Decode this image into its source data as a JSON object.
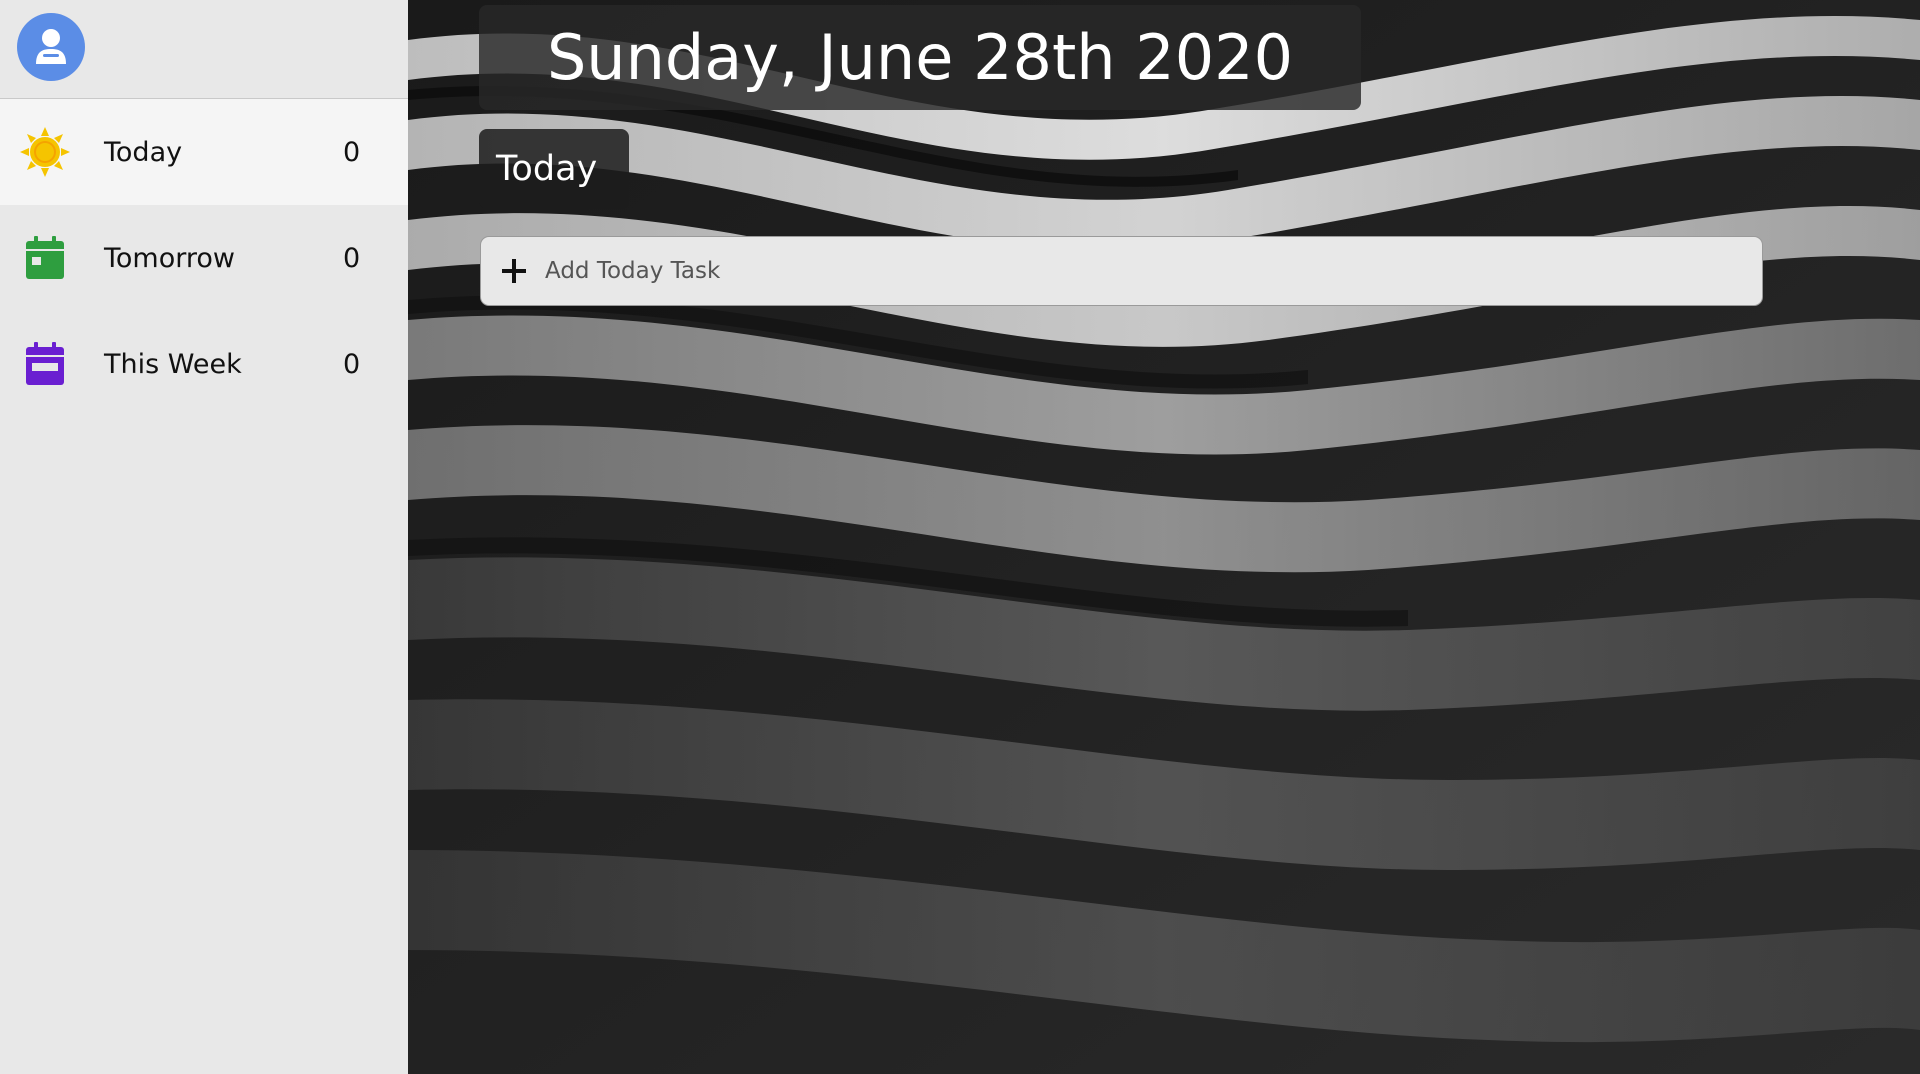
{
  "header": {
    "date_title": "Sunday, June 28th 2020"
  },
  "sidebar": {
    "avatar_icon": "user-icon",
    "items": [
      {
        "label": "Today",
        "count": "0",
        "icon": "sun-icon",
        "color": "#f5c400",
        "active": true
      },
      {
        "label": "Tomorrow",
        "count": "0",
        "icon": "calendar-icon",
        "color": "#2e9e3f",
        "active": false
      },
      {
        "label": "This Week",
        "count": "0",
        "icon": "calendar-week-icon",
        "color": "#6a1fd1",
        "active": false
      }
    ]
  },
  "main": {
    "section_title": "Today",
    "add_task": {
      "placeholder": "Add Today Task",
      "icon": "plus-icon"
    }
  },
  "colors": {
    "sidebar_bg": "#e8e8e8",
    "active_bg": "#f5f5f5",
    "avatar_bg": "#5b8de6"
  }
}
